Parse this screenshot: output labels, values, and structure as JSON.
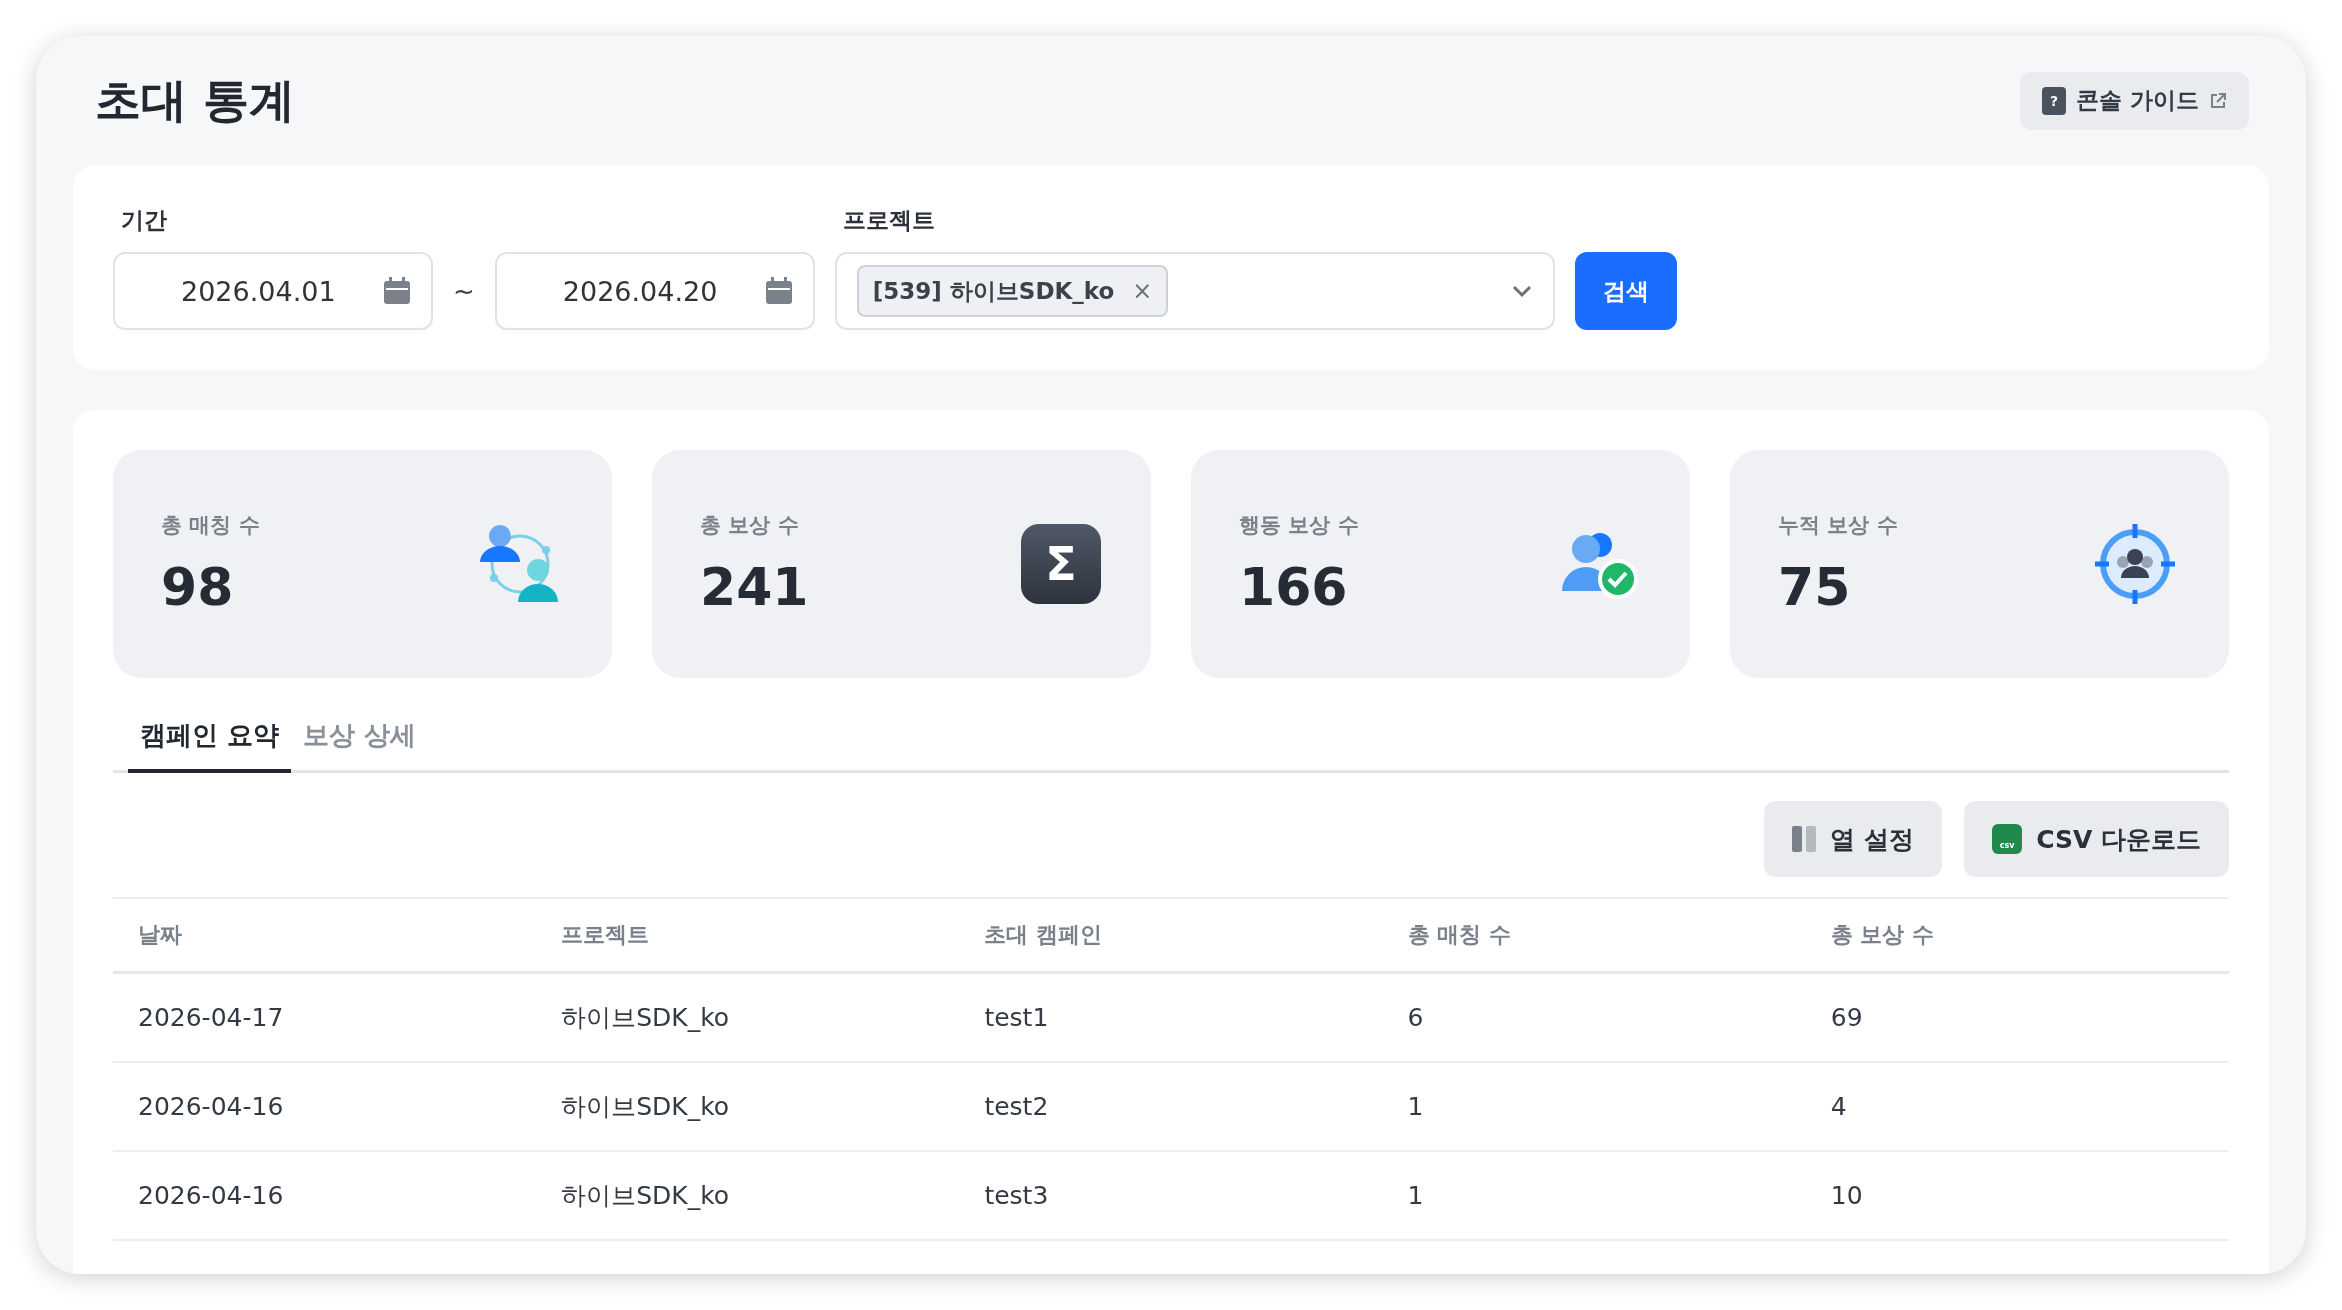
{
  "page": {
    "title": "초대 통계",
    "guide_icon_glyph": "?",
    "guide_button": "콘솔 가이드"
  },
  "filters": {
    "period_label": "기간",
    "start_date": "2026.04.01",
    "separator": "~",
    "end_date": "2026.04.20",
    "project_label": "프로젝트",
    "project_tags": [
      {
        "label": "[539] 하이브SDK_ko",
        "remove": "×"
      }
    ],
    "search_button": "검색"
  },
  "stats": [
    {
      "kind": "matching",
      "label": "총 매칭 수",
      "value": "98"
    },
    {
      "kind": "sum",
      "label": "총 보상 수",
      "value": "241",
      "icon_glyph": "Σ"
    },
    {
      "kind": "action",
      "label": "행동 보상 수",
      "value": "166"
    },
    {
      "kind": "target",
      "label": "누적 보상 수",
      "value": "75"
    }
  ],
  "tabs": [
    {
      "label": "캠페인 요약",
      "selected": true
    },
    {
      "label": "보상 상세",
      "selected": false
    }
  ],
  "toolbar": [
    {
      "kind": "columns",
      "label": "열 설정"
    },
    {
      "kind": "csv",
      "label": "CSV 다운로드",
      "icon_text": "csv"
    }
  ],
  "table": {
    "columns": [
      "날짜",
      "프로젝트",
      "초대 캠페인",
      "총 매칭 수",
      "총 보상 수"
    ],
    "rows": [
      [
        "2026-04-17",
        "하이브SDK_ko",
        "test1",
        "6",
        "69"
      ],
      [
        "2026-04-16",
        "하이브SDK_ko",
        "test2",
        "1",
        "4"
      ],
      [
        "2026-04-16",
        "하이브SDK_ko",
        "test3",
        "1",
        "10"
      ]
    ]
  }
}
